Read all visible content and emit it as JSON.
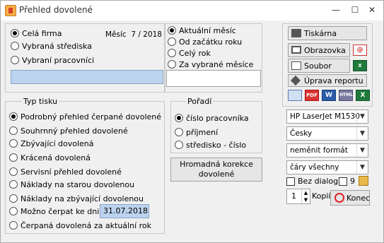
{
  "window": {
    "title": "Přehled dovolené",
    "minimize": "—",
    "maximize": "☐",
    "close": "✕"
  },
  "scope": {
    "options": [
      "Celá firma",
      "Vybraná střediska",
      "Vybraní pracovníci"
    ],
    "selected": 0,
    "month_label": "Měsíc",
    "month_value": "7 / 2018"
  },
  "period": {
    "options": [
      "Aktuální měsíc",
      "Od začátku roku",
      "Celý rok",
      "Za vybrané měsíce"
    ],
    "selected": 0
  },
  "print_type": {
    "title": "Typ tisku",
    "options": [
      "Podrobný přehled čerpané dovolené",
      "Souhrnný přehled dovolené",
      "Zbývající dovolená",
      "Krácená dovolená",
      "Servisní přehled dovolené",
      "Náklady na starou dovolenou",
      "Náklady na zbývající dovolenou",
      "Možno čerpat ke dni",
      "Čerpaná dovolená za aktuální rok"
    ],
    "selected": 0,
    "date_value": "31.07.2018"
  },
  "order": {
    "title": "Pořadí",
    "options": [
      "číslo pracovníka",
      "příjmení",
      "středisko - číslo"
    ],
    "selected": 0,
    "bulk_button": "Hromadná korekce dovolené"
  },
  "output": {
    "printer_button": "Tiskárna",
    "screen_button": "Obrazovka",
    "file_button": "Soubor",
    "edit_report_button": "Úprava reportu",
    "formats": [
      "PDF",
      "W",
      "HTML",
      "X"
    ]
  },
  "settings": {
    "printer": "HP LaserJet M1530",
    "language": "Česky",
    "format": "neměnit formát",
    "lines": "čáry všechny",
    "no_dialog_label": "Bez dialogu",
    "copies_label": "Kopií",
    "copies_value": "1",
    "count_value": "9",
    "end_button": "Konec"
  }
}
